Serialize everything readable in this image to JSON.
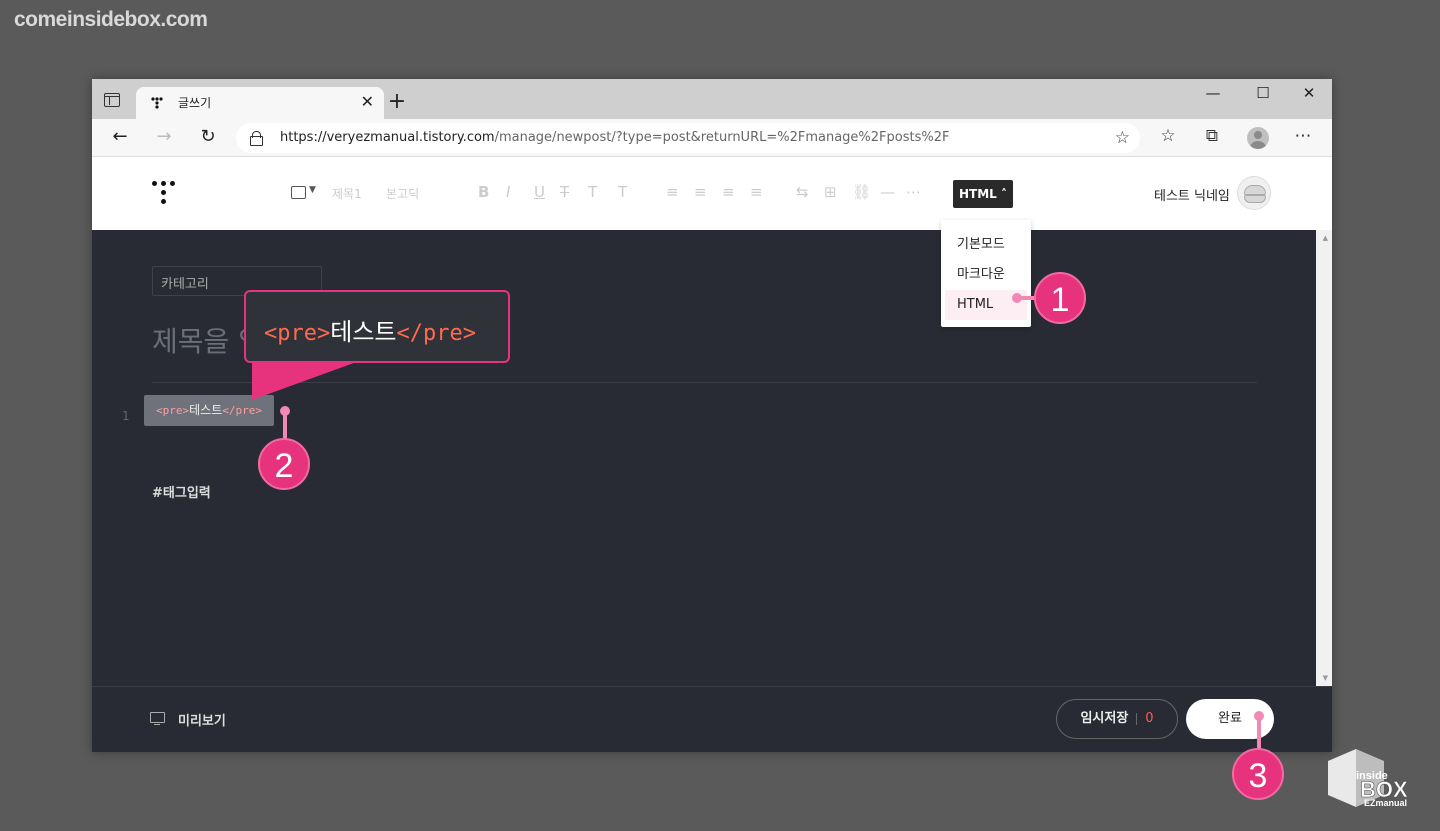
{
  "watermark": "comeinsidebox.com",
  "browser": {
    "tab_title": "글쓰기",
    "url_main": "https://veryezmanual.tistory.com",
    "url_rest": "/manage/newpost/?type=post&returnURL=%2Fmanage%2Fposts%2F"
  },
  "editor": {
    "format_heading": "제목1",
    "format_font": "본고딕",
    "mode_button": "HTML",
    "nickname": "테스트 닉네임",
    "category_placeholder": "카테고리",
    "title_placeholder": "제목을 입력하세요",
    "line_number": "1",
    "code": {
      "open_tag": "<pre>",
      "text": "테스트",
      "close_tag": "</pre>"
    },
    "tag_placeholder": "#태그입력"
  },
  "mode_dropdown": {
    "items": [
      {
        "label": "기본모드"
      },
      {
        "label": "마크다운"
      },
      {
        "label": "HTML"
      }
    ]
  },
  "zoom_callout": {
    "open_tag": "<pre>",
    "text": "테스트",
    "close_tag": "</pre>"
  },
  "footer": {
    "preview_label": "미리보기",
    "draft_label": "임시저장",
    "draft_count": "0",
    "publish_label": "완료"
  },
  "markers": [
    "1",
    "2",
    "3"
  ],
  "brand": {
    "line1": "inside",
    "line2": "BOX",
    "line3": "EZmanual"
  },
  "colors": {
    "accent_pink": "#e7337e",
    "editor_bg": "#282b33",
    "tag_red": "#ff6a4f"
  }
}
